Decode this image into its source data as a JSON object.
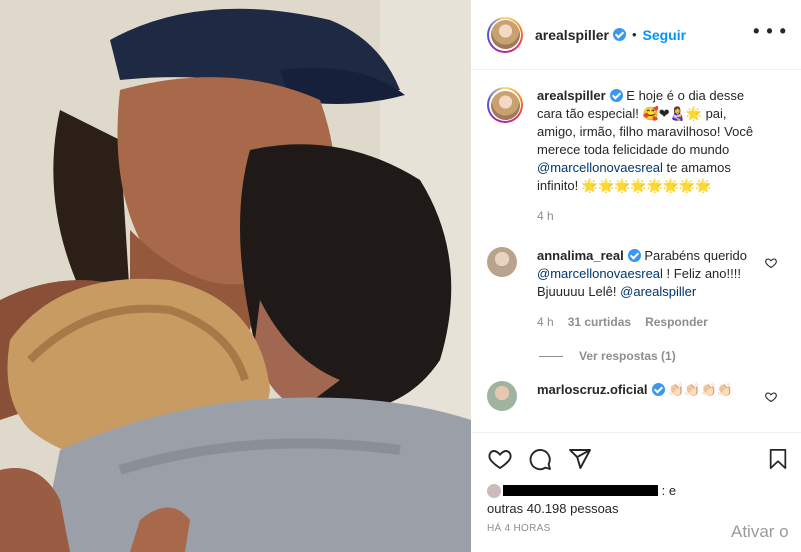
{
  "post": {
    "author": "arealspiller",
    "follow_label": "Seguir",
    "separator": "•",
    "more_icon": "ellipsis-icon"
  },
  "caption": {
    "username": "arealspiller",
    "text_1": "E hoje é o dia desse cara tão especial! 🥰❤👩‍🍼🌟 pai, amigo, irmão, filho maravilhoso! Você merece toda felicidade do mundo",
    "mention": "@marcellonovaesreal",
    "text_2": "te amamos infinito! 🌟🌟🌟🌟🌟🌟🌟🌟",
    "time": "4 h"
  },
  "comments": [
    {
      "username": "annalima_real",
      "text_1": "Parabéns querido",
      "mention_1": "@marcellonovaesreal",
      "text_2": "! Feliz ano!!!! Bjuuuuu Lelê!",
      "mention_2": "@arealspiller",
      "time": "4 h",
      "likes": "31 curtidas",
      "reply": "Responder",
      "view_replies": "Ver respostas (1)"
    },
    {
      "username": "marloscruz.oficial",
      "text": "👏🏻👏🏻👏🏻👏🏻"
    }
  ],
  "likes": {
    "suffix": ": e",
    "line2": "outras 40.198 pessoas"
  },
  "time_ago": "HÁ 4 HORAS",
  "watermark": "Ativar o",
  "colors": {
    "accent": "#0095f6",
    "mention": "#00376b",
    "muted": "#8e8e8e",
    "verified": "#3897f0"
  }
}
